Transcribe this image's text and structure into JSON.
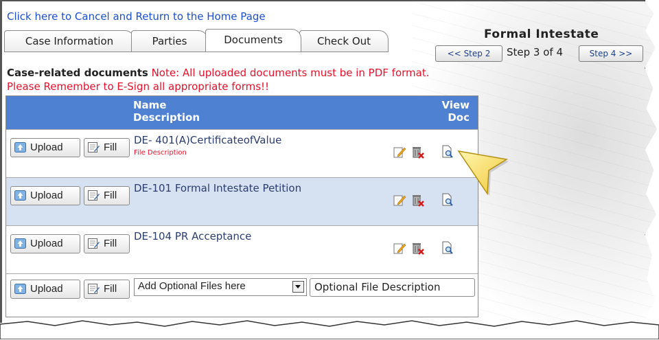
{
  "cancel_link": "Click here to Cancel and Return to the Home Page",
  "tabs": [
    {
      "label": "Case Information",
      "active": false
    },
    {
      "label": "Parties",
      "active": false
    },
    {
      "label": "Documents",
      "active": true
    },
    {
      "label": "Check Out",
      "active": false
    }
  ],
  "wizard": {
    "title": "Formal Intestate",
    "prev_label": "<< Step 2",
    "status": "Step 3 of 4",
    "next_label": "Step 4 >>"
  },
  "section": {
    "title": "Case-related documents",
    "note": "Note: All uploaded documents must be in PDF format.",
    "reminder": "Please Remember to E-Sign all appropriate forms!!"
  },
  "table": {
    "header_name": "Name",
    "header_desc": "Description",
    "header_view": "View",
    "header_doc": "Doc",
    "rows": [
      {
        "name": "DE- 401(A)CertificateofValue",
        "description": "File Description"
      },
      {
        "name": "DE-101 Formal Intestate Petition",
        "description": ""
      },
      {
        "name": "DE-104 PR Acceptance",
        "description": ""
      }
    ],
    "upload_label": "Upload",
    "fill_label": "Fill",
    "optional_select_value": "Add Optional Files here",
    "optional_description_value": "Optional File Description"
  },
  "icons": {
    "upload": "upload-icon",
    "fill": "fill-form-icon",
    "edit": "edit-icon",
    "delete": "delete-icon",
    "view": "view-document-icon",
    "callout": "pointer-callout"
  },
  "colors": {
    "header_bg": "#4f81d3",
    "alt_row": "#d6e1f1",
    "link": "#1c4fd6",
    "note_red": "#e8102a"
  }
}
